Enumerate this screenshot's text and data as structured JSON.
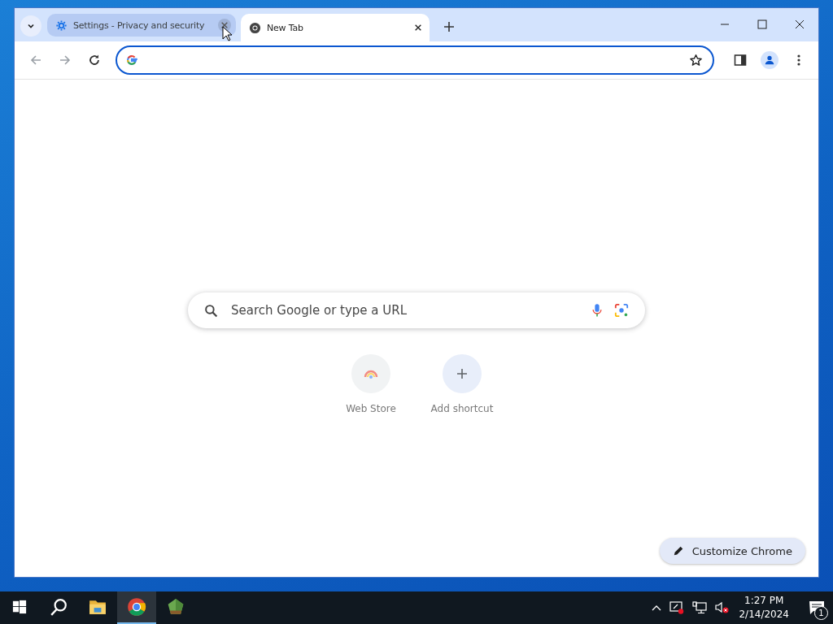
{
  "tabs": [
    {
      "kind": "settings",
      "title": "Settings - Privacy and security",
      "selected": false,
      "hovered": true
    },
    {
      "kind": "newtab",
      "title": "New Tab",
      "selected": true,
      "hovered": false
    }
  ],
  "search": {
    "placeholder": "Search Google or type a URL"
  },
  "shortcuts": [
    {
      "label": "Web Store",
      "kind": "site"
    },
    {
      "label": "Add shortcut",
      "kind": "add"
    }
  ],
  "customize_button": {
    "label": "Customize Chrome"
  },
  "taskbar": {
    "apps": [
      {
        "kind": "start",
        "selected": false
      },
      {
        "kind": "search",
        "selected": false
      },
      {
        "kind": "files",
        "selected": false
      },
      {
        "kind": "chrome",
        "selected": true
      },
      {
        "kind": "gem",
        "selected": false
      }
    ],
    "time": "1:27 PM",
    "date": "2/14/2024",
    "notifications": "1"
  }
}
